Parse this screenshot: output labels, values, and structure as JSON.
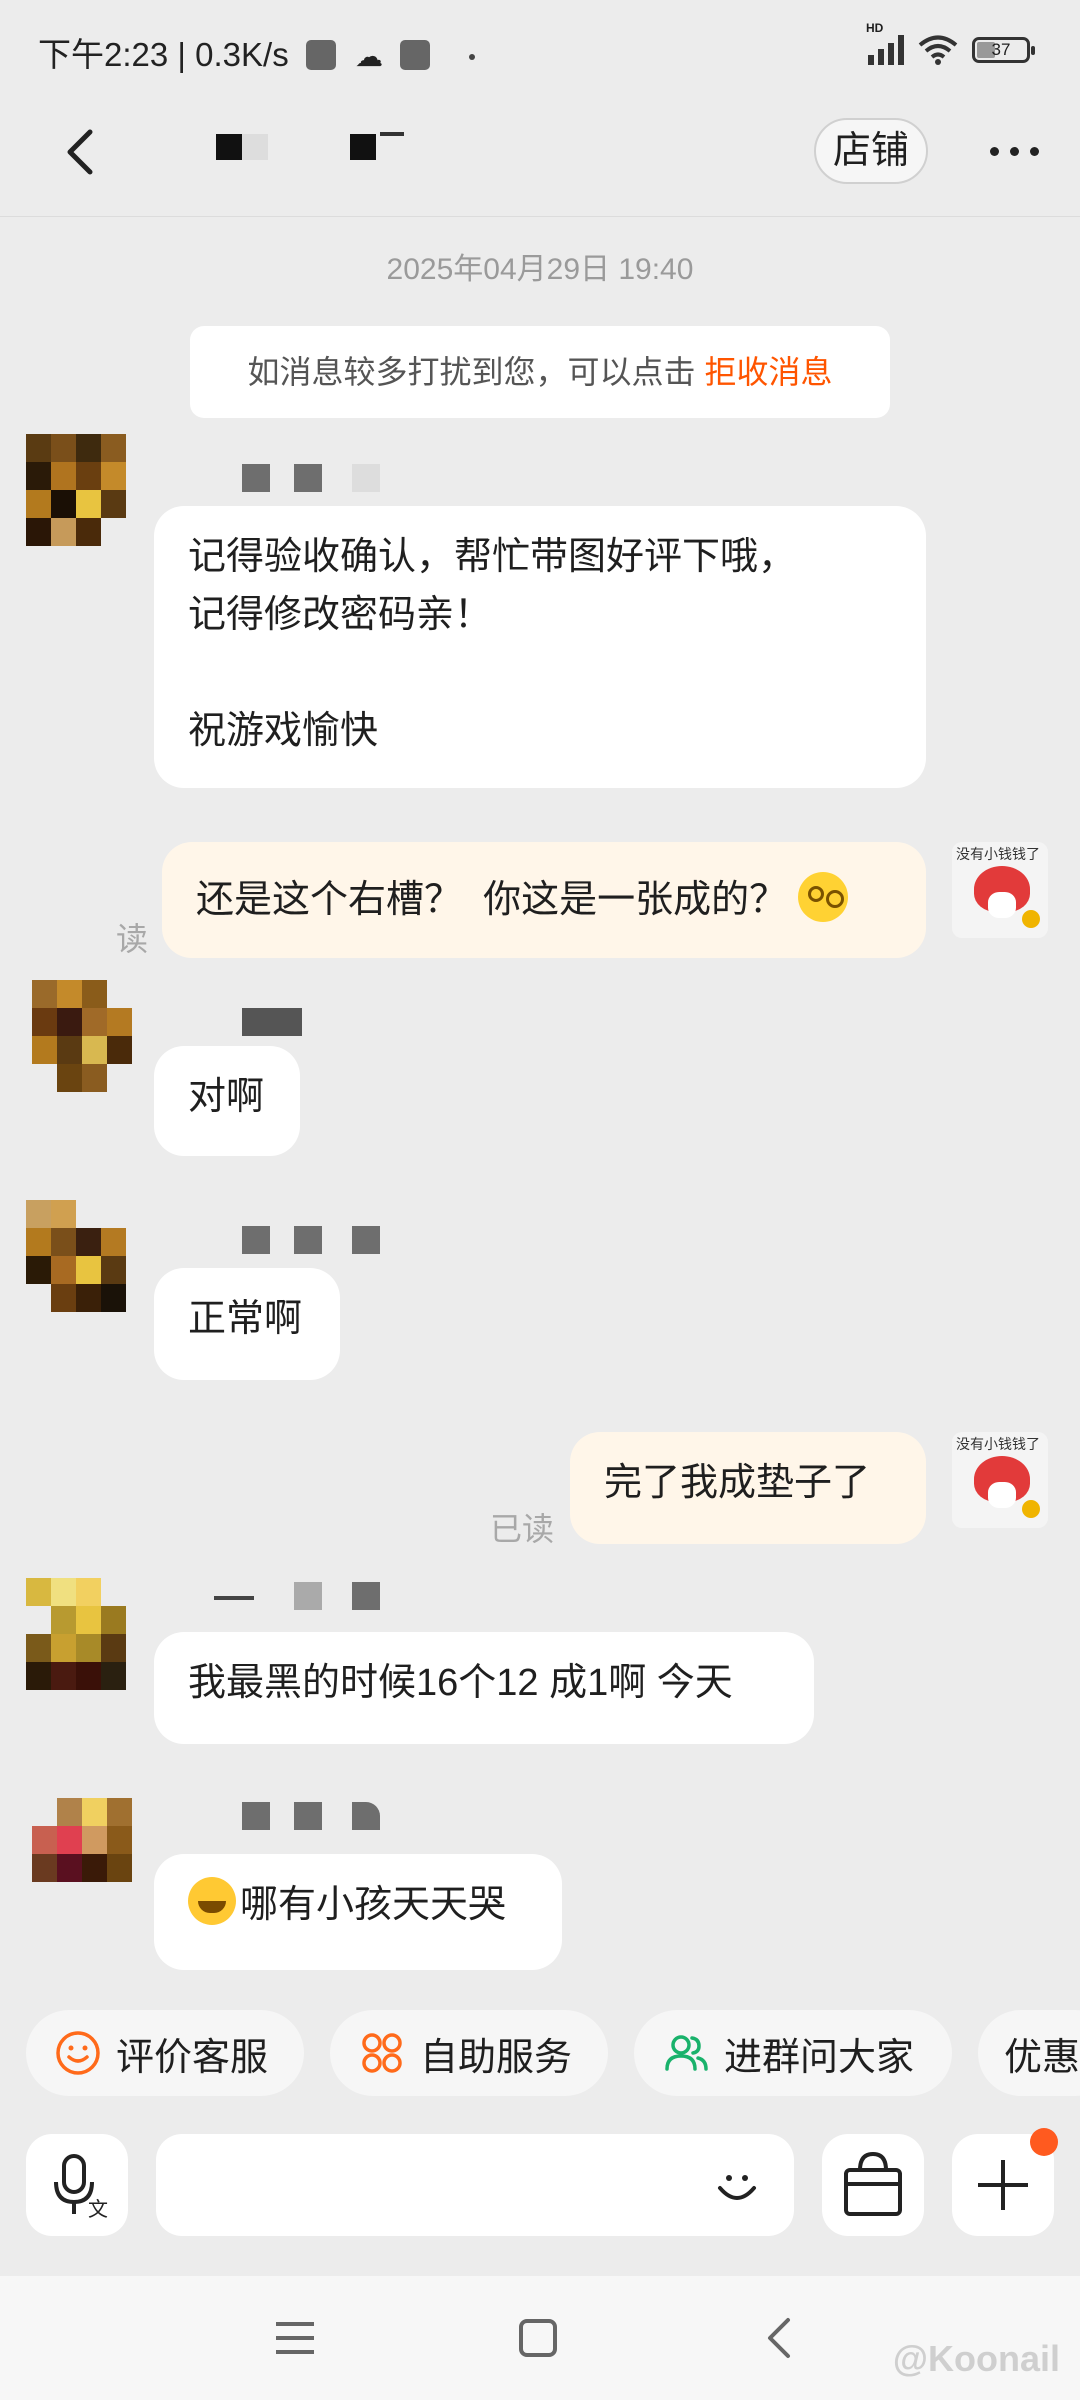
{
  "status_bar": {
    "time": "下午2:23",
    "speed": "0.3K/s",
    "network_tag": "HD",
    "battery": "37"
  },
  "header": {
    "store_label": "店铺"
  },
  "chat": {
    "timestamp": "2025年04月29日 19:40",
    "notice_text": "如消息较多打扰到您，可以点击",
    "notice_link": "拒收消息",
    "messages": [
      {
        "sender": "shop",
        "text": "记得验收确认，帮忙带图好评下哦，\n记得修改密码亲！\n\n祝游戏愉快"
      },
      {
        "sender": "me",
        "text": "还是这个右槽？  你这是一张成的？",
        "read_label": "读"
      },
      {
        "sender": "shop",
        "text": "对啊"
      },
      {
        "sender": "shop",
        "text": "正常啊"
      },
      {
        "sender": "me",
        "text": "完了我成垫子了",
        "read_label": "已读"
      },
      {
        "sender": "shop",
        "text": "我最黑的时候16个12 成1啊 今天"
      },
      {
        "sender": "shop",
        "text": "哪有小孩天天哭"
      }
    ],
    "self_avatar_caption": "没有小钱钱了"
  },
  "quick_actions": [
    {
      "label": "评价客服",
      "icon": "smile-icon",
      "color": "#ff6a1a"
    },
    {
      "label": "自助服务",
      "icon": "grid-flower-icon",
      "color": "#ff6a1a"
    },
    {
      "label": "进群问大家",
      "icon": "group-icon",
      "color": "#19b26b"
    },
    {
      "label": "优惠",
      "icon": "",
      "color": "#ff6a1a"
    }
  ],
  "input": {
    "placeholder": ""
  },
  "watermark": "@Koonail"
}
